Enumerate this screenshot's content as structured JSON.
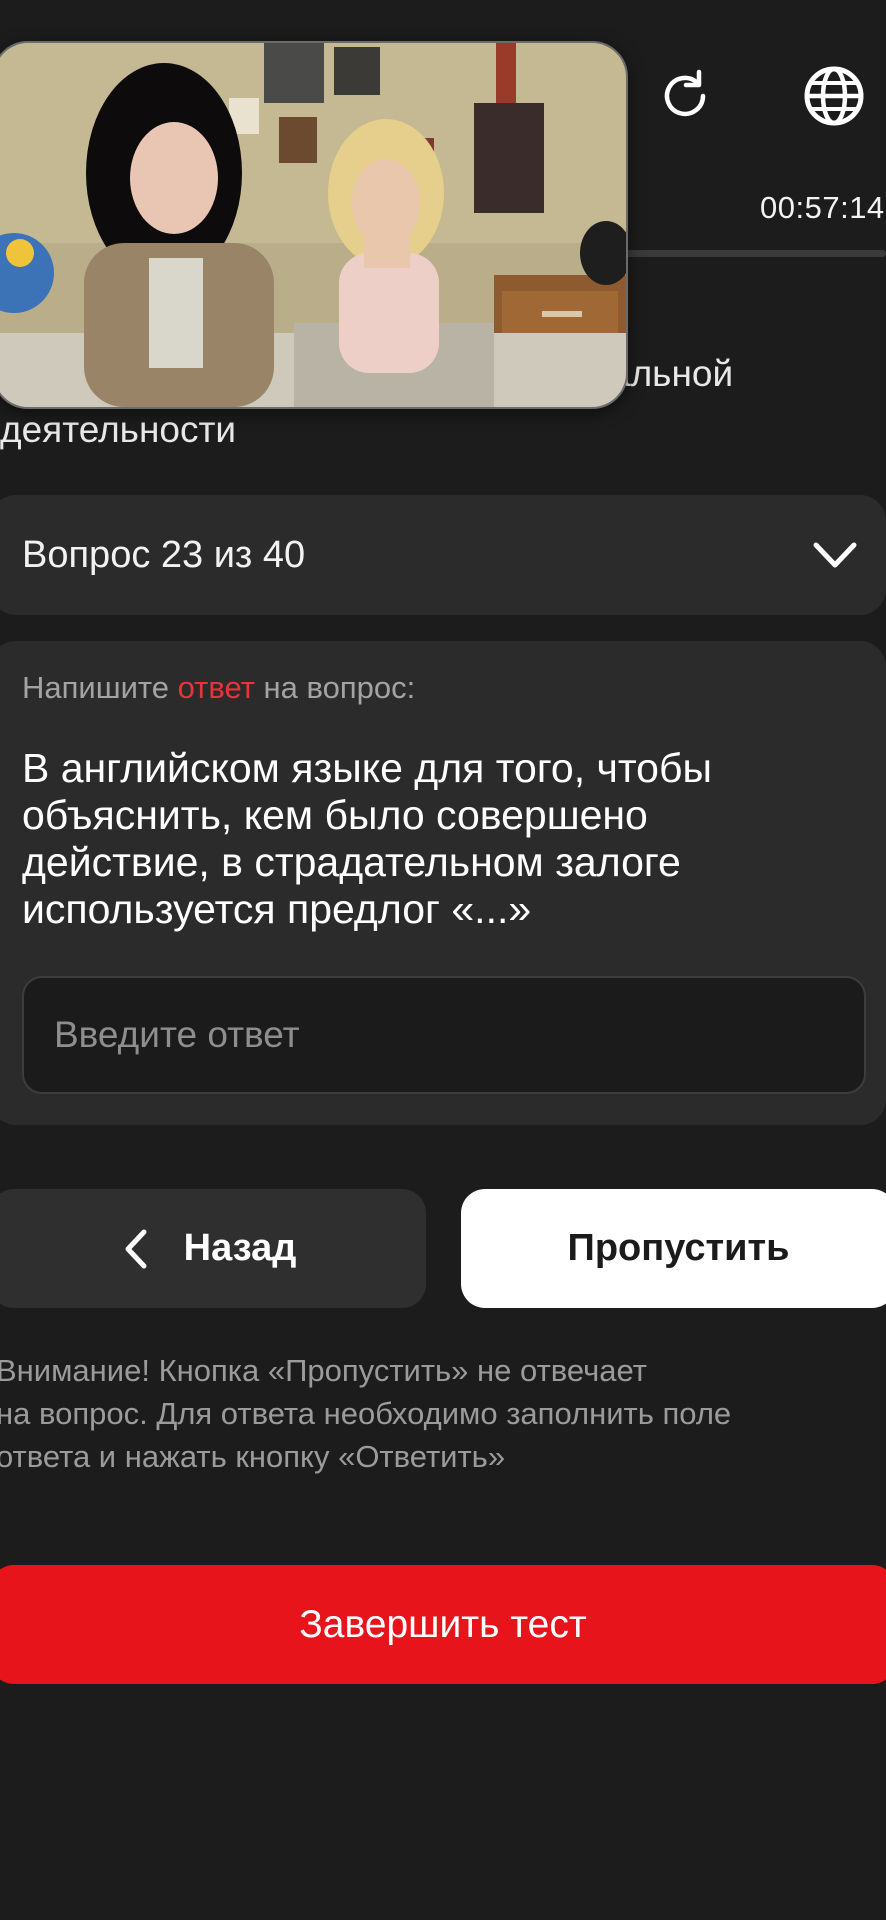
{
  "header": {
    "reload_icon": "reload-icon",
    "language_icon": "globe-icon",
    "timer": "00:57:14"
  },
  "course": {
    "title_line1": "альной",
    "title_line2": "деятельности"
  },
  "video": {
    "icon": "video-thumbnail"
  },
  "question_selector": {
    "label": "Вопрос 23 из 40",
    "icon": "chevron-down-icon"
  },
  "question": {
    "prompt_before": "Напишите ",
    "prompt_accent": "ответ",
    "prompt_after": " на вопрос:",
    "line1": "В английском языке для того, чтобы",
    "line2": "объяснить, кем было совершено",
    "line3": "действие, в страдательном залоге",
    "line4": "используется предлог «...»",
    "answer_value": "",
    "answer_placeholder": "Введите ответ"
  },
  "actions": {
    "back_label": "Назад",
    "skip_label": "Пропустить",
    "finish_label": "Завершить тест"
  },
  "warning": {
    "line1": "Внимание! Кнопка «Пропустить» не отвечает",
    "line2": "на вопрос. Для ответа необходимо заполнить поле",
    "line3": "ответа и нажать кнопку «Ответить»"
  },
  "colors": {
    "background": "#1c1c1c",
    "card": "#2b2b2b",
    "accent_red": "#e8141c",
    "prompt_accent": "#e8333a"
  }
}
